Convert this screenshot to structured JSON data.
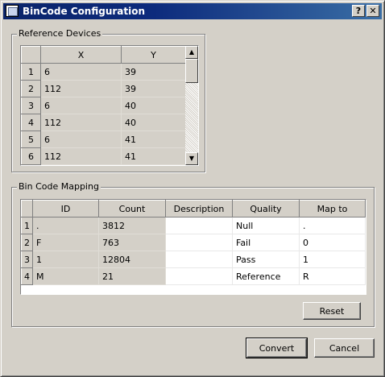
{
  "window": {
    "title": "BinCode Configuration",
    "help_label": "?",
    "close_label": "✕"
  },
  "reference_devices": {
    "label": "Reference Devices",
    "columns": [
      "X",
      "Y"
    ],
    "rows": [
      {
        "num": "1",
        "x": "6",
        "y": "39"
      },
      {
        "num": "2",
        "x": "112",
        "y": "39"
      },
      {
        "num": "3",
        "x": "6",
        "y": "40"
      },
      {
        "num": "4",
        "x": "112",
        "y": "40"
      },
      {
        "num": "5",
        "x": "6",
        "y": "41"
      },
      {
        "num": "6",
        "x": "112",
        "y": "41"
      }
    ],
    "scroll_up_icon": "arrow-up-icon",
    "scroll_down_icon": "arrow-down-icon"
  },
  "bin_code_mapping": {
    "label": "Bin Code Mapping",
    "columns": [
      "ID",
      "Count",
      "Description",
      "Quality",
      "Map to"
    ],
    "rows": [
      {
        "num": "1",
        "id": ".",
        "count": "3812",
        "description": "",
        "quality": "Null",
        "map_to": "."
      },
      {
        "num": "2",
        "id": "F",
        "count": "763",
        "description": "",
        "quality": "Fail",
        "map_to": "0"
      },
      {
        "num": "3",
        "id": "1",
        "count": "12804",
        "description": "",
        "quality": "Pass",
        "map_to": "1"
      },
      {
        "num": "4",
        "id": "M",
        "count": "21",
        "description": "",
        "quality": "Reference",
        "map_to": "R"
      }
    ],
    "reset_label": "Reset"
  },
  "footer": {
    "convert_label": "Convert",
    "cancel_label": "Cancel"
  }
}
